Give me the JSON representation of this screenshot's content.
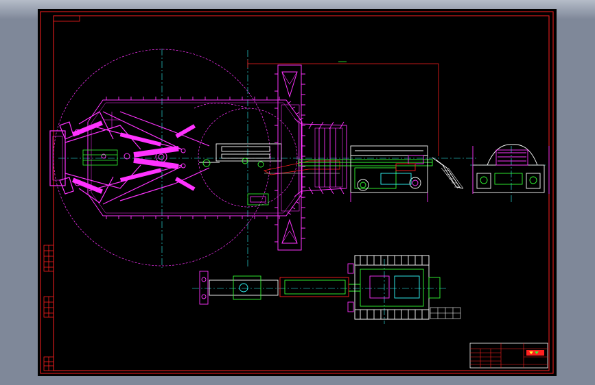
{
  "drawing": {
    "frame_color": "#ff2020",
    "colors": {
      "magenta": "#ff33ff",
      "green": "#33ff33",
      "white": "#ffffff",
      "cyan": "#33ffff",
      "red": "#ff2020",
      "yellow": "#ffff33"
    },
    "title_block": {
      "title": "",
      "label_a": "",
      "label_b": ""
    }
  }
}
